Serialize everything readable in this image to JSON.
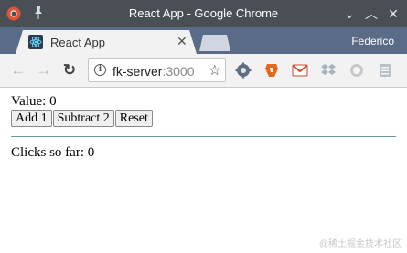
{
  "window": {
    "title": "React App - Google Chrome",
    "controls": {
      "minimize": "⌄",
      "maximize": "︿",
      "close": "✕"
    }
  },
  "tabs": [
    {
      "label": "React App",
      "close": "✕",
      "active": true
    }
  ],
  "profile": {
    "name": "Federico"
  },
  "toolbar": {
    "url_host": "fk-server",
    "url_port": ":3000",
    "back": "←",
    "forward": "→",
    "reload": "↻",
    "bookmark": "☆"
  },
  "extensions": [
    "gear-extension",
    "brave-extension",
    "gmail-extension",
    "dropbox-extension",
    "circle-extension",
    "menu-extension"
  ],
  "app": {
    "value_label": "Value: 0",
    "buttons": {
      "add": "Add 1",
      "subtract": "Subtract 2",
      "reset": "Reset"
    },
    "clicks_label": "Clicks so far: 0"
  },
  "watermark": "@稀土掘金技术社区",
  "colors": {
    "titlebar": "#4a4f55",
    "tabbar": "#5a6b87",
    "toolbar": "#f2f2f2",
    "divider": "#6a9aa0"
  }
}
